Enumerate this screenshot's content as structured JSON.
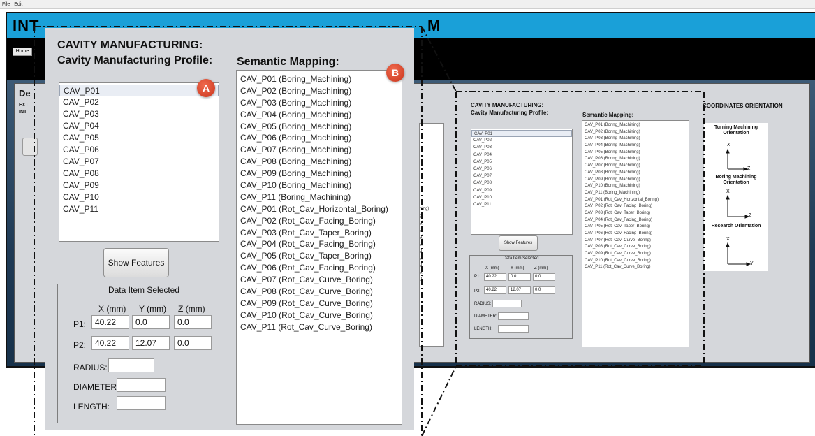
{
  "menubar": {
    "items": [
      "File",
      "Edit"
    ]
  },
  "app": {
    "title": "INT",
    "title_tail": "M",
    "home_label": "Home",
    "section_heading": "De",
    "ext_line1": "EXT",
    "ext_line2": "INT",
    "ghost_list": [
      "ning)",
      "g)",
      "g)",
      "g)",
      "g)",
      "g)",
      "g)",
      "g)",
      "g)",
      "g)",
      "g)"
    ]
  },
  "zoom": {
    "heading": "CAVITY MANUFACTURING:",
    "profile_heading": "Cavity Manufacturing Profile:",
    "mapping_heading": "Semantic Mapping:",
    "profiles": [
      "CAV_P01",
      "CAV_P02",
      "CAV_P03",
      "CAV_P04",
      "CAV_P05",
      "CAV_P06",
      "CAV_P07",
      "CAV_P08",
      "CAV_P09",
      "CAV_P10",
      "CAV_P11"
    ],
    "mappings": [
      "CAV_P01 (Boring_Machining)",
      "CAV_P02 (Boring_Machining)",
      "CAV_P03 (Boring_Machining)",
      "CAV_P04 (Boring_Machining)",
      "CAV_P05 (Boring_Machining)",
      "CAV_P06 (Boring_Machining)",
      "CAV_P07 (Boring_Machining)",
      "CAV_P08 (Boring_Machining)",
      "CAV_P09 (Boring_Machining)",
      "CAV_P10 (Boring_Machining)",
      "CAV_P11 (Boring_Machining)",
      "CAV_P01 (Rot_Cav_Horizontal_Boring)",
      "CAV_P02 (Rot_Cav_Facing_Boring)",
      "CAV_P03 (Rot_Cav_Taper_Boring)",
      "CAV_P04 (Rot_Cav_Facing_Boring)",
      "CAV_P05 (Rot_Cav_Taper_Boring)",
      "CAV_P06 (Rot_Cav_Facing_Boring)",
      "CAV_P07 (Rot_Cav_Curve_Boring)",
      "CAV_P08 (Rot_Cav_Curve_Boring)",
      "CAV_P09 (Rot_Cav_Curve_Boring)",
      "CAV_P10 (Rot_Cav_Curve_Boring)",
      "CAV_P11 (Rot_Cav_Curve_Boring)"
    ],
    "show_features_label": "Show Features",
    "data_item": {
      "title": "Data Item Selected",
      "x_label": "X (mm)",
      "y_label": "Y (mm)",
      "z_label": "Z (mm)",
      "p1_label": "P1:",
      "p2_label": "P2:",
      "p1": {
        "x": "40.22",
        "y": "0.0",
        "z": "0.0"
      },
      "p2": {
        "x": "40.22",
        "y": "12.07",
        "z": "0.0"
      },
      "radius_label": "RADIUS:",
      "diameter_label": "DIAMETER:",
      "length_label": "LENGTH:",
      "radius": "",
      "diameter": "",
      "length": ""
    }
  },
  "callouts": {
    "a": "A",
    "b": "B"
  },
  "coordinates": {
    "title": "COORDINATES ORIENTATION",
    "turning": "Turning Machining Orientation",
    "boring": "Boring Machining Orientation",
    "research": "Research Orientation",
    "x": "X",
    "z": "Z",
    "y": "Y"
  },
  "colors": {
    "header_blue": "#1aa0d8",
    "panel_grey": "#d5d7db",
    "callout_red": "#d9432a"
  }
}
